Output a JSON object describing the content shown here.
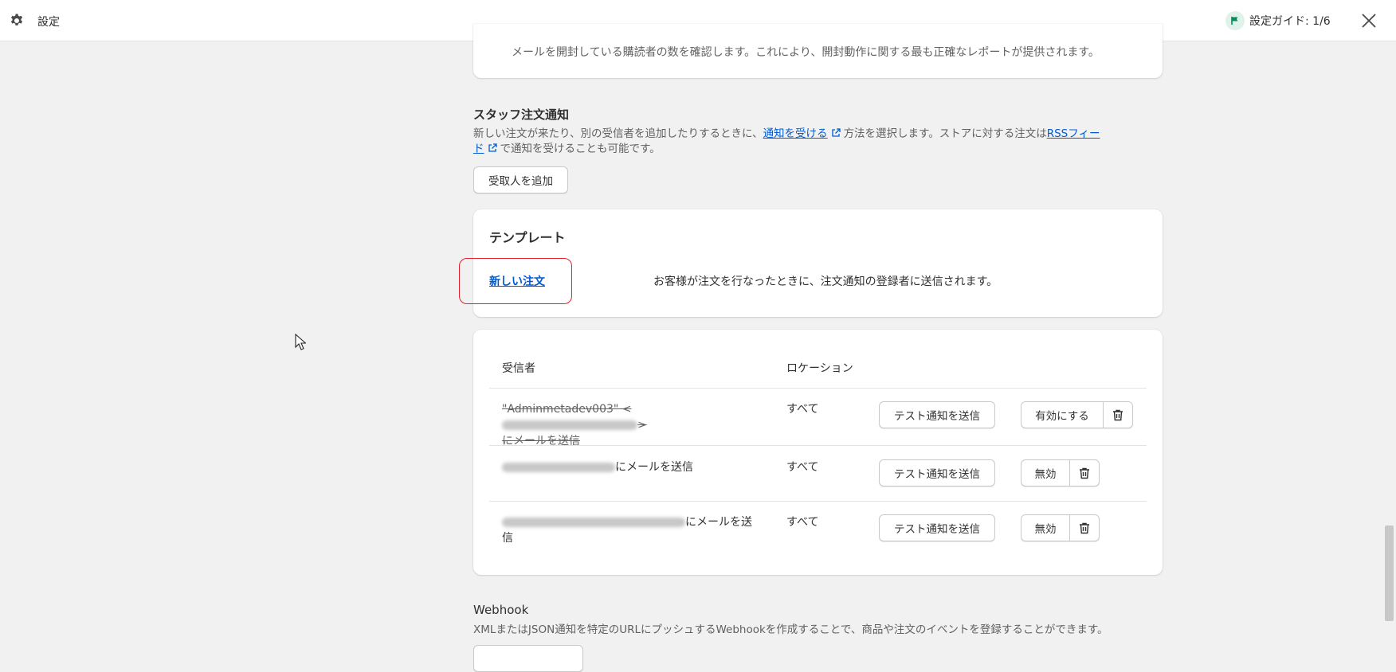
{
  "topbar": {
    "title": "設定",
    "guide_label": "設定ガイド: 1/6",
    "gear_icon": "gear-icon",
    "flag_icon": "flag-icon",
    "close_icon": "close-icon"
  },
  "open_tracking": {
    "description": "メールを開封している購読者の数を確認します。これにより、開封動作に関する最も正確なレポートが提供されます。"
  },
  "staff_notifications": {
    "title": "スタッフ注文通知",
    "desc_part1": "新しい注文が来たり、別の受信者を追加したりするときに、",
    "link1": "通知を受ける",
    "desc_part2": "方法を選択します。ストアに対する注文は",
    "link2_a": "RSSフィー",
    "link2_b": "ド",
    "desc_part3": "で通知を受けることも可能です。",
    "add_recipient_button": "受取人を追加"
  },
  "templates": {
    "title": "テンプレート",
    "new_order_link": "新しい注文",
    "new_order_desc": "お客様が注文を行なったときに、注文通知の登録者に送信されます。"
  },
  "recipients": {
    "header_recipient": "受信者",
    "header_location": "ロケーション",
    "rows": [
      {
        "prefix": "\"Adminmetadev003\" <",
        "suffix": ">",
        "line2": "にメールを送信",
        "location": "すべて",
        "test_button": "テスト通知を送信",
        "toggle_button": "有効にする",
        "disabled_style": true
      },
      {
        "suffix": "にメールを送信",
        "location": "すべて",
        "test_button": "テスト通知を送信",
        "toggle_button": "無効"
      },
      {
        "suffix": "にメールを送",
        "line2": "信",
        "location": "すべて",
        "test_button": "テスト通知を送信",
        "toggle_button": "無効"
      }
    ]
  },
  "webhook": {
    "title": "Webhook",
    "description": "XMLまたはJSON通知を特定のURLにプッシュするWebhookを作成することで、商品や注文のイベントを登録することができます。"
  },
  "colors": {
    "link": "#005bd3",
    "highlight": "#e5202e",
    "background": "#f1f1f1",
    "guide_flag": "#0a8a5a"
  }
}
